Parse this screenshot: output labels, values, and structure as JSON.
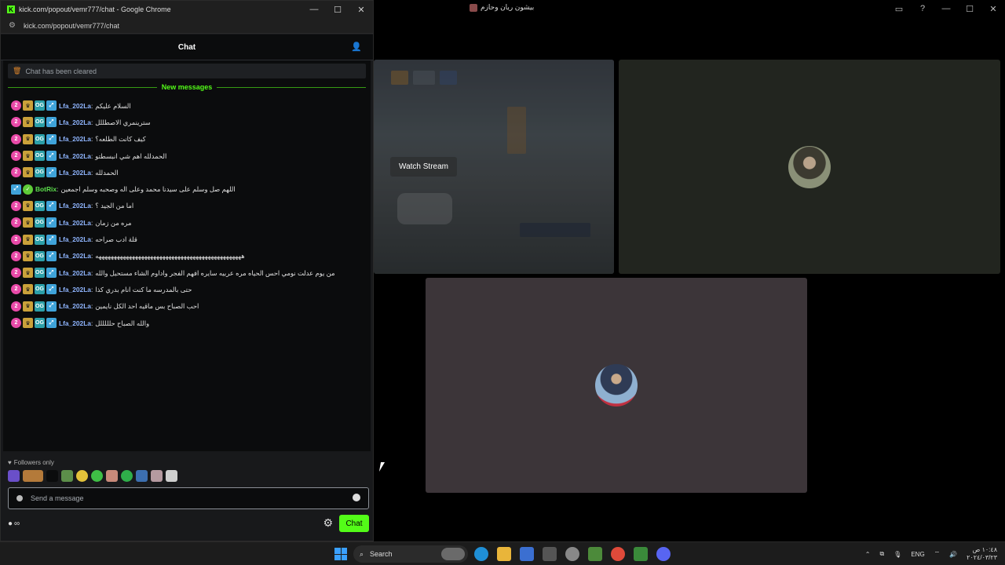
{
  "background_window": {
    "title": "بيشون ريان وحازم",
    "controls": [
      "▭",
      "?",
      "—",
      "☐",
      "✕"
    ],
    "stream_tile": {
      "watch_button": "Watch Stream"
    }
  },
  "chrome": {
    "window_title": "kick.com/popout/vemr777/chat - Google Chrome",
    "url": "kick.com/popout/vemr777/chat",
    "controls": {
      "minimize": "—",
      "maximize": "☐",
      "close": "✕"
    }
  },
  "chat": {
    "header": "Chat",
    "cleared_notice": "Chat has been cleared",
    "new_messages_label": "New messages",
    "messages": [
      {
        "user": "Lfa_202La",
        "text": "السلام عليكم",
        "bot": false
      },
      {
        "user": "Lfa_202La",
        "text": "سترينمري الاصطللل",
        "bot": false
      },
      {
        "user": "Lfa_202La",
        "text": "كيف كانت الطلعه؟",
        "bot": false
      },
      {
        "user": "Lfa_202La",
        "text": "الحمدلله اهم شي انبسطتو",
        "bot": false
      },
      {
        "user": "Lfa_202La",
        "text": "الحمدلله",
        "bot": false
      },
      {
        "user": "BotRix",
        "text": "اللهم صل وسلم على سيدنا محمد وعلى اله وصحبه وسلم اجمعين",
        "bot": true
      },
      {
        "user": "Lfa_202La",
        "text": "اما من الجيد ؟",
        "bot": false
      },
      {
        "user": "Lfa_202La",
        "text": "مره من زمان",
        "bot": false
      },
      {
        "user": "Lfa_202La",
        "text": "قلة ادب صراحه",
        "bot": false
      },
      {
        "user": "Lfa_202La",
        "text": "ههههههههههههههههههههههههههههههههههههههههههههههههه",
        "bot": false
      },
      {
        "user": "Lfa_202La",
        "text": "من يوم عدلت نومي احس الحياه مره عربيه سايره افهم الفجر واداوم الشاء مستحيل والله",
        "bot": false
      },
      {
        "user": "Lfa_202La",
        "text": "حتى بالمدرسه ما كنت انام بدري كذا",
        "bot": false
      },
      {
        "user": "Lfa_202La",
        "text": "احب الصباح بس ماقيه احد الكل نايمين",
        "bot": false
      },
      {
        "user": "Lfa_202La",
        "text": "والله الصباح حلللللل",
        "bot": false
      }
    ],
    "followers_only": "Followers only",
    "input_placeholder": "Send a message",
    "points_label": "∞",
    "send_button": "Chat"
  },
  "taskbar": {
    "search_label": "Search",
    "language": "ENG",
    "time": "١٠:٤٨ ص",
    "date": "٢٠٢٤/٠٣/٢٣"
  },
  "colors": {
    "kick_green": "#53fc18",
    "username_blue": "#8fb5ff",
    "bot_green": "#5de04d"
  }
}
